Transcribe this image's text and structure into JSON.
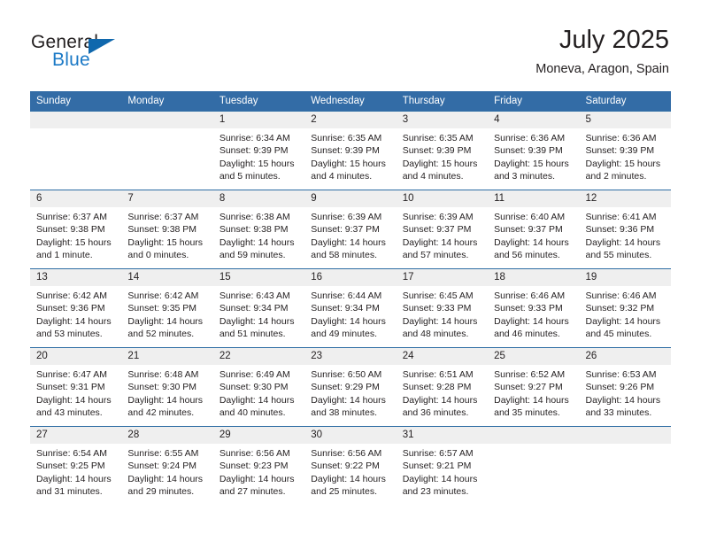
{
  "brand": {
    "word_general": "General",
    "word_blue": "Blue",
    "accent_color": "#1b79c6"
  },
  "header": {
    "title": "July 2025",
    "subtitle": "Moneva, Aragon, Spain"
  },
  "theme": {
    "header_row_bg": "#336ca6",
    "daynum_strip_bg": "#efefef",
    "row_divider": "#2e6da4",
    "text": "#231f20"
  },
  "weekday_headers": [
    "Sunday",
    "Monday",
    "Tuesday",
    "Wednesday",
    "Thursday",
    "Friday",
    "Saturday"
  ],
  "weeks": [
    [
      {
        "day": "",
        "sunrise": "",
        "sunset": "",
        "daylight1": "",
        "daylight2": ""
      },
      {
        "day": "",
        "sunrise": "",
        "sunset": "",
        "daylight1": "",
        "daylight2": ""
      },
      {
        "day": "1",
        "sunrise": "Sunrise: 6:34 AM",
        "sunset": "Sunset: 9:39 PM",
        "daylight1": "Daylight: 15 hours",
        "daylight2": "and 5 minutes."
      },
      {
        "day": "2",
        "sunrise": "Sunrise: 6:35 AM",
        "sunset": "Sunset: 9:39 PM",
        "daylight1": "Daylight: 15 hours",
        "daylight2": "and 4 minutes."
      },
      {
        "day": "3",
        "sunrise": "Sunrise: 6:35 AM",
        "sunset": "Sunset: 9:39 PM",
        "daylight1": "Daylight: 15 hours",
        "daylight2": "and 4 minutes."
      },
      {
        "day": "4",
        "sunrise": "Sunrise: 6:36 AM",
        "sunset": "Sunset: 9:39 PM",
        "daylight1": "Daylight: 15 hours",
        "daylight2": "and 3 minutes."
      },
      {
        "day": "5",
        "sunrise": "Sunrise: 6:36 AM",
        "sunset": "Sunset: 9:39 PM",
        "daylight1": "Daylight: 15 hours",
        "daylight2": "and 2 minutes."
      }
    ],
    [
      {
        "day": "6",
        "sunrise": "Sunrise: 6:37 AM",
        "sunset": "Sunset: 9:38 PM",
        "daylight1": "Daylight: 15 hours",
        "daylight2": "and 1 minute."
      },
      {
        "day": "7",
        "sunrise": "Sunrise: 6:37 AM",
        "sunset": "Sunset: 9:38 PM",
        "daylight1": "Daylight: 15 hours",
        "daylight2": "and 0 minutes."
      },
      {
        "day": "8",
        "sunrise": "Sunrise: 6:38 AM",
        "sunset": "Sunset: 9:38 PM",
        "daylight1": "Daylight: 14 hours",
        "daylight2": "and 59 minutes."
      },
      {
        "day": "9",
        "sunrise": "Sunrise: 6:39 AM",
        "sunset": "Sunset: 9:37 PM",
        "daylight1": "Daylight: 14 hours",
        "daylight2": "and 58 minutes."
      },
      {
        "day": "10",
        "sunrise": "Sunrise: 6:39 AM",
        "sunset": "Sunset: 9:37 PM",
        "daylight1": "Daylight: 14 hours",
        "daylight2": "and 57 minutes."
      },
      {
        "day": "11",
        "sunrise": "Sunrise: 6:40 AM",
        "sunset": "Sunset: 9:37 PM",
        "daylight1": "Daylight: 14 hours",
        "daylight2": "and 56 minutes."
      },
      {
        "day": "12",
        "sunrise": "Sunrise: 6:41 AM",
        "sunset": "Sunset: 9:36 PM",
        "daylight1": "Daylight: 14 hours",
        "daylight2": "and 55 minutes."
      }
    ],
    [
      {
        "day": "13",
        "sunrise": "Sunrise: 6:42 AM",
        "sunset": "Sunset: 9:36 PM",
        "daylight1": "Daylight: 14 hours",
        "daylight2": "and 53 minutes."
      },
      {
        "day": "14",
        "sunrise": "Sunrise: 6:42 AM",
        "sunset": "Sunset: 9:35 PM",
        "daylight1": "Daylight: 14 hours",
        "daylight2": "and 52 minutes."
      },
      {
        "day": "15",
        "sunrise": "Sunrise: 6:43 AM",
        "sunset": "Sunset: 9:34 PM",
        "daylight1": "Daylight: 14 hours",
        "daylight2": "and 51 minutes."
      },
      {
        "day": "16",
        "sunrise": "Sunrise: 6:44 AM",
        "sunset": "Sunset: 9:34 PM",
        "daylight1": "Daylight: 14 hours",
        "daylight2": "and 49 minutes."
      },
      {
        "day": "17",
        "sunrise": "Sunrise: 6:45 AM",
        "sunset": "Sunset: 9:33 PM",
        "daylight1": "Daylight: 14 hours",
        "daylight2": "and 48 minutes."
      },
      {
        "day": "18",
        "sunrise": "Sunrise: 6:46 AM",
        "sunset": "Sunset: 9:33 PM",
        "daylight1": "Daylight: 14 hours",
        "daylight2": "and 46 minutes."
      },
      {
        "day": "19",
        "sunrise": "Sunrise: 6:46 AM",
        "sunset": "Sunset: 9:32 PM",
        "daylight1": "Daylight: 14 hours",
        "daylight2": "and 45 minutes."
      }
    ],
    [
      {
        "day": "20",
        "sunrise": "Sunrise: 6:47 AM",
        "sunset": "Sunset: 9:31 PM",
        "daylight1": "Daylight: 14 hours",
        "daylight2": "and 43 minutes."
      },
      {
        "day": "21",
        "sunrise": "Sunrise: 6:48 AM",
        "sunset": "Sunset: 9:30 PM",
        "daylight1": "Daylight: 14 hours",
        "daylight2": "and 42 minutes."
      },
      {
        "day": "22",
        "sunrise": "Sunrise: 6:49 AM",
        "sunset": "Sunset: 9:30 PM",
        "daylight1": "Daylight: 14 hours",
        "daylight2": "and 40 minutes."
      },
      {
        "day": "23",
        "sunrise": "Sunrise: 6:50 AM",
        "sunset": "Sunset: 9:29 PM",
        "daylight1": "Daylight: 14 hours",
        "daylight2": "and 38 minutes."
      },
      {
        "day": "24",
        "sunrise": "Sunrise: 6:51 AM",
        "sunset": "Sunset: 9:28 PM",
        "daylight1": "Daylight: 14 hours",
        "daylight2": "and 36 minutes."
      },
      {
        "day": "25",
        "sunrise": "Sunrise: 6:52 AM",
        "sunset": "Sunset: 9:27 PM",
        "daylight1": "Daylight: 14 hours",
        "daylight2": "and 35 minutes."
      },
      {
        "day": "26",
        "sunrise": "Sunrise: 6:53 AM",
        "sunset": "Sunset: 9:26 PM",
        "daylight1": "Daylight: 14 hours",
        "daylight2": "and 33 minutes."
      }
    ],
    [
      {
        "day": "27",
        "sunrise": "Sunrise: 6:54 AM",
        "sunset": "Sunset: 9:25 PM",
        "daylight1": "Daylight: 14 hours",
        "daylight2": "and 31 minutes."
      },
      {
        "day": "28",
        "sunrise": "Sunrise: 6:55 AM",
        "sunset": "Sunset: 9:24 PM",
        "daylight1": "Daylight: 14 hours",
        "daylight2": "and 29 minutes."
      },
      {
        "day": "29",
        "sunrise": "Sunrise: 6:56 AM",
        "sunset": "Sunset: 9:23 PM",
        "daylight1": "Daylight: 14 hours",
        "daylight2": "and 27 minutes."
      },
      {
        "day": "30",
        "sunrise": "Sunrise: 6:56 AM",
        "sunset": "Sunset: 9:22 PM",
        "daylight1": "Daylight: 14 hours",
        "daylight2": "and 25 minutes."
      },
      {
        "day": "31",
        "sunrise": "Sunrise: 6:57 AM",
        "sunset": "Sunset: 9:21 PM",
        "daylight1": "Daylight: 14 hours",
        "daylight2": "and 23 minutes."
      },
      {
        "day": "",
        "sunrise": "",
        "sunset": "",
        "daylight1": "",
        "daylight2": ""
      },
      {
        "day": "",
        "sunrise": "",
        "sunset": "",
        "daylight1": "",
        "daylight2": ""
      }
    ]
  ]
}
